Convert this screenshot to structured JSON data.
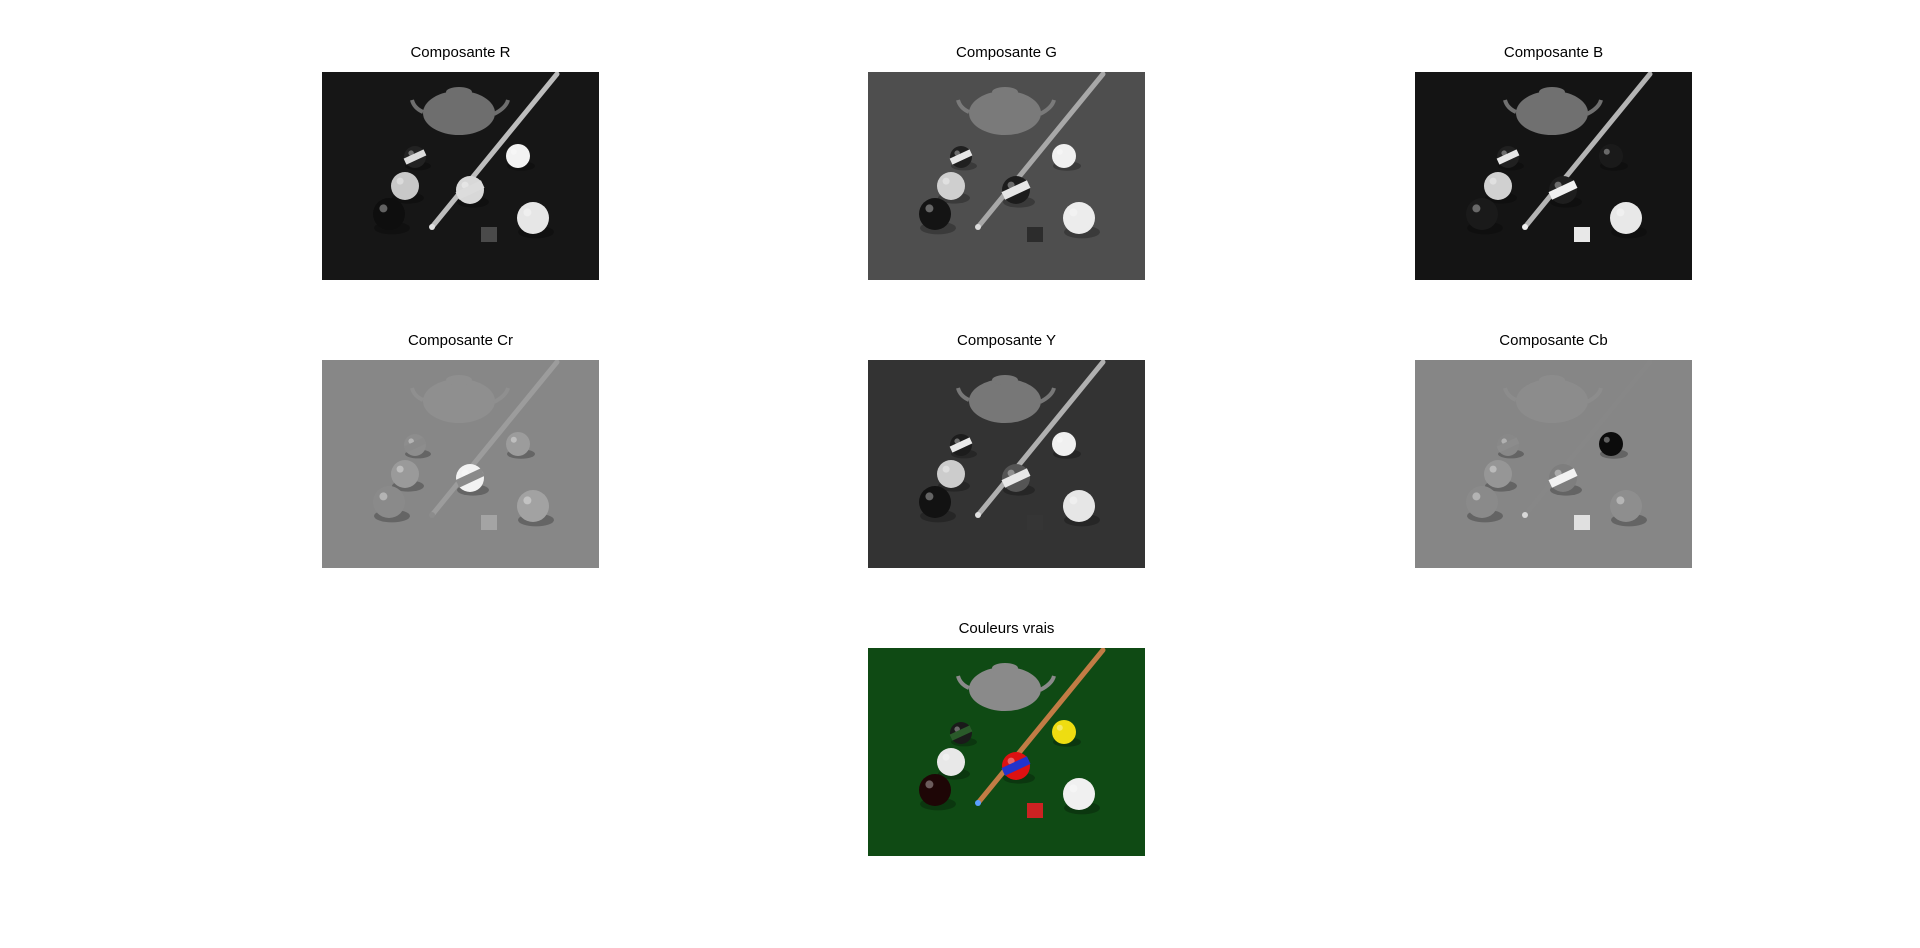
{
  "figure": {
    "panels": [
      {
        "title": "Composante R",
        "image": "pool-table-scene-r-channel",
        "colors": {
          "bg": "#161616",
          "teapot": "#6e6e6e",
          "cue": "#bdbdbd",
          "cue_tip": "#e0e0e0",
          "cube": "#4a4a4a",
          "balls": [
            "#0e0e0e",
            "#c8c8c8",
            "#e6e6e6",
            "#d8d8d8",
            "#f2f2f2",
            "#222222"
          ],
          "stripes": [
            "#dcdcdc",
            "#dcdcdc"
          ]
        }
      },
      {
        "title": "Composante G",
        "image": "pool-table-scene-g-channel",
        "colors": {
          "bg": "#4e4e4e",
          "teapot": "#7a7a7a",
          "cue": "#a8a8a8",
          "cue_tip": "#dcdcdc",
          "cube": "#2c2c2c",
          "balls": [
            "#141414",
            "#cfcfcf",
            "#ececec",
            "#1c1c1c",
            "#f0f0f0",
            "#202020"
          ],
          "stripes": [
            "#e6e6e6",
            "#e6e6e6"
          ]
        }
      },
      {
        "title": "Composante B",
        "image": "pool-table-scene-b-channel",
        "colors": {
          "bg": "#141414",
          "teapot": "#707070",
          "cue": "#b4b4b4",
          "cue_tip": "#f0f0f0",
          "cube": "#e8e8e8",
          "balls": [
            "#1a1a1a",
            "#d0d0d0",
            "#e8e8e8",
            "#1e1e1e",
            "#1a1a1a",
            "#202020"
          ],
          "stripes": [
            "#f0f0f0",
            "#e6e6e6"
          ]
        }
      },
      {
        "title": "Composante Cr",
        "image": "pool-table-scene-cr-channel",
        "colors": {
          "bg": "#878787",
          "teapot": "#8f8f8f",
          "cue": "#9c9c9c",
          "cue_tip": "#8c8c8c",
          "cube": "#a4a4a4",
          "balls": [
            "#8a8a8a",
            "#9a9a9a",
            "#a2a2a2",
            "#f2f2f2",
            "#9c9c9c",
            "#8d8d8d"
          ],
          "stripes": [
            "#8a8a8a",
            "#8a8a8a"
          ]
        }
      },
      {
        "title": "Composante Y",
        "image": "pool-table-scene-y-channel",
        "colors": {
          "bg": "#333333",
          "teapot": "#777777",
          "cue": "#b0b0b0",
          "cue_tip": "#e0e0e0",
          "cube": "#353535",
          "balls": [
            "#121212",
            "#cccccc",
            "#e6e6e6",
            "#555555",
            "#f0f0f0",
            "#1c1c1c"
          ],
          "stripes": [
            "#e8e8e8",
            "#e8e8e8"
          ]
        }
      },
      {
        "title": "Composante Cb",
        "image": "pool-table-scene-cb-channel",
        "colors": {
          "bg": "#868686",
          "teapot": "#8c8c8c",
          "cue": "#878787",
          "cue_tip": "#d8d8d8",
          "cube": "#e0e0e0",
          "balls": [
            "#8a8a8a",
            "#969696",
            "#8e8e8e",
            "#7e7e7e",
            "#0c0c0c",
            "#888888"
          ],
          "stripes": [
            "#f2f2f2",
            "#8c8c8c"
          ]
        }
      },
      {
        "title": "Couleurs vrais",
        "image": "pool-table-scene-true-color",
        "colors": {
          "bg": "#0f4a14",
          "teapot": "#8a8a8a",
          "cue": "#c27c45",
          "cue_tip": "#5aa0ff",
          "cube": "#cc2222",
          "balls": [
            "#1e0606",
            "#e8e8e8",
            "#f0f0f0",
            "#dd1111",
            "#eedd11",
            "#1a1a1a"
          ],
          "stripes": [
            "#2233cc",
            "#2a5a2a"
          ]
        }
      }
    ]
  }
}
